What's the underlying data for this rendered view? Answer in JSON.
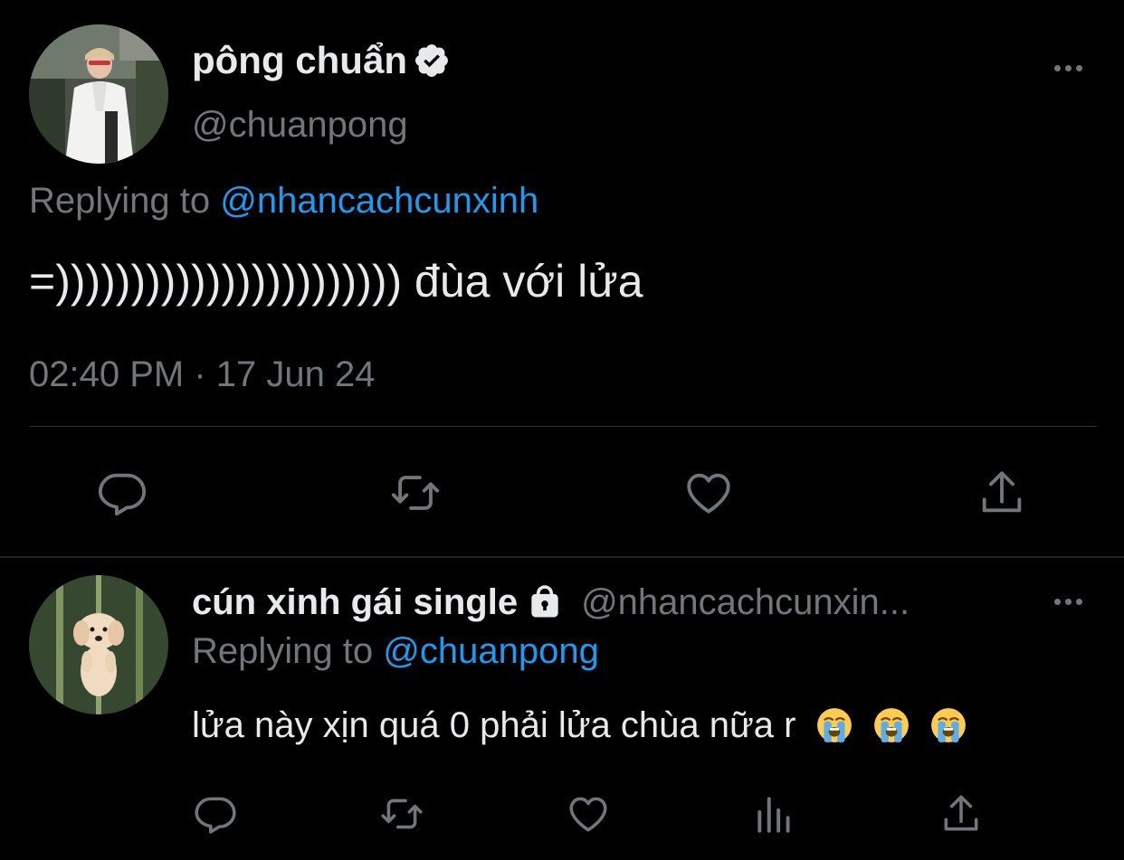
{
  "main_tweet": {
    "author": {
      "display_name": "pông chuẩn",
      "handle": "@chuanpong",
      "verified": true
    },
    "replying_label": "Replying to",
    "replying_to": "@nhancachcunxinh",
    "text": "=))))))))))))))))))))))) đùa với lửa",
    "timestamp": "02:40 PM · 17 Jun 24",
    "actions": [
      "reply-icon",
      "retweet-icon",
      "like-icon",
      "share-icon"
    ]
  },
  "reply_tweet": {
    "author": {
      "display_name": "cún xinh gái single",
      "handle": "@nhancachcunxin...",
      "protected": true
    },
    "replying_label": "Replying to",
    "replying_to": "@chuanpong",
    "text": "lửa này xịn quá 0 phải lửa chùa nữa r",
    "emojis": [
      "loudly-crying-face",
      "loudly-crying-face",
      "loudly-crying-face"
    ],
    "actions": [
      "reply-icon",
      "retweet-icon",
      "like-icon",
      "analytics-icon",
      "share-icon"
    ]
  },
  "colors": {
    "background": "#000000",
    "text": "#e7e9ea",
    "muted": "#71767b",
    "link": "#1d9bf0",
    "divider": "#2f3336"
  }
}
